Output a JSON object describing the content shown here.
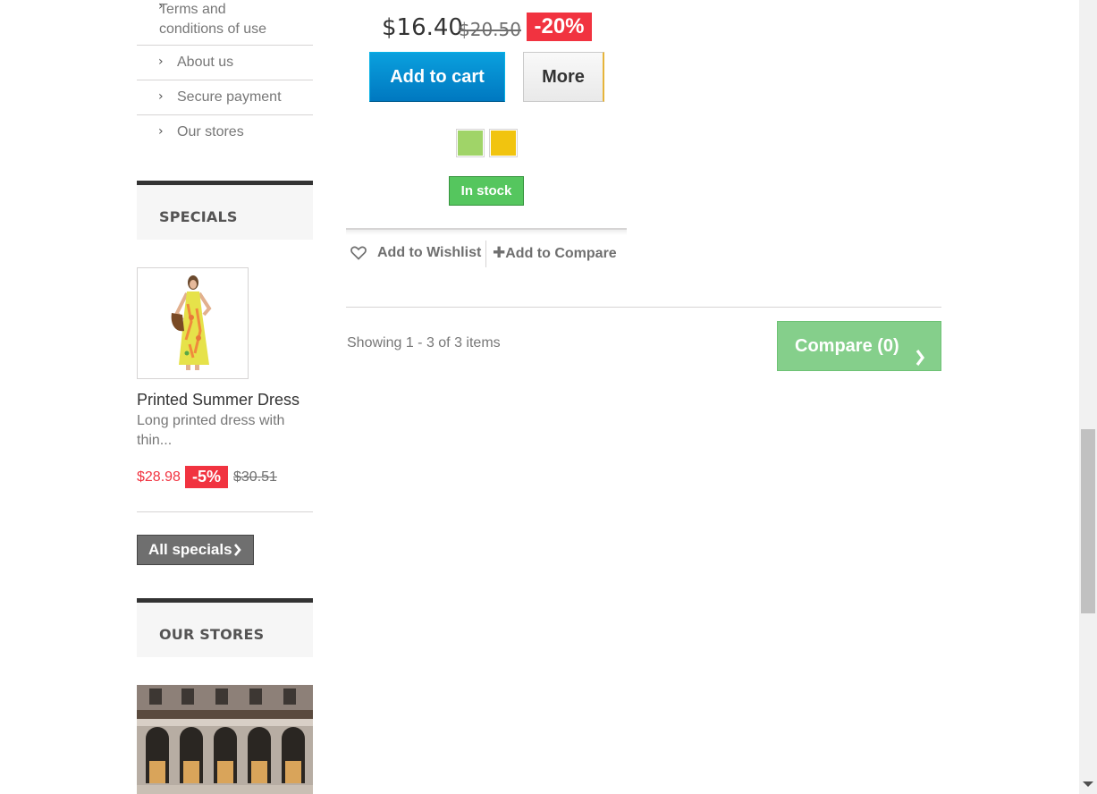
{
  "sidebar": {
    "info_links": [
      {
        "label": "Terms and conditions of use"
      },
      {
        "label": "About us"
      },
      {
        "label": "Secure payment"
      },
      {
        "label": "Our stores"
      }
    ],
    "specials": {
      "heading": "SPECIALS",
      "product_name": "Printed Summer Dress",
      "description": "Long printed dress with thin...",
      "price": "$28.98",
      "reduction": "-5%",
      "old_price": "$30.51",
      "all_specials_label": "All specials"
    },
    "stores": {
      "heading": "OUR STORES"
    }
  },
  "product": {
    "price": "$16.40",
    "old_price": "$20.50",
    "reduction": "-20%",
    "add_to_cart_label": "Add to cart",
    "more_label": "More",
    "color_swatches": [
      "#a0d468",
      "#f1c40f"
    ],
    "availability": "In stock",
    "wishlist_label": "Add to Wishlist",
    "compare_label": "Add to Compare"
  },
  "listing": {
    "showing_text": "Showing 1 - 3 of 3 items",
    "compare_button_label": "Compare (0)"
  },
  "colors": {
    "reduction_red": "#f13340",
    "cart_blue": "#0078c0",
    "stock_green": "#55c65e",
    "compare_green": "#85cf8b"
  },
  "icons": {
    "info_chevron": "chevron-right-icon",
    "wishlist": "heart-icon",
    "compare": "plus-icon",
    "button_chevron": "chevron-right-icon"
  }
}
